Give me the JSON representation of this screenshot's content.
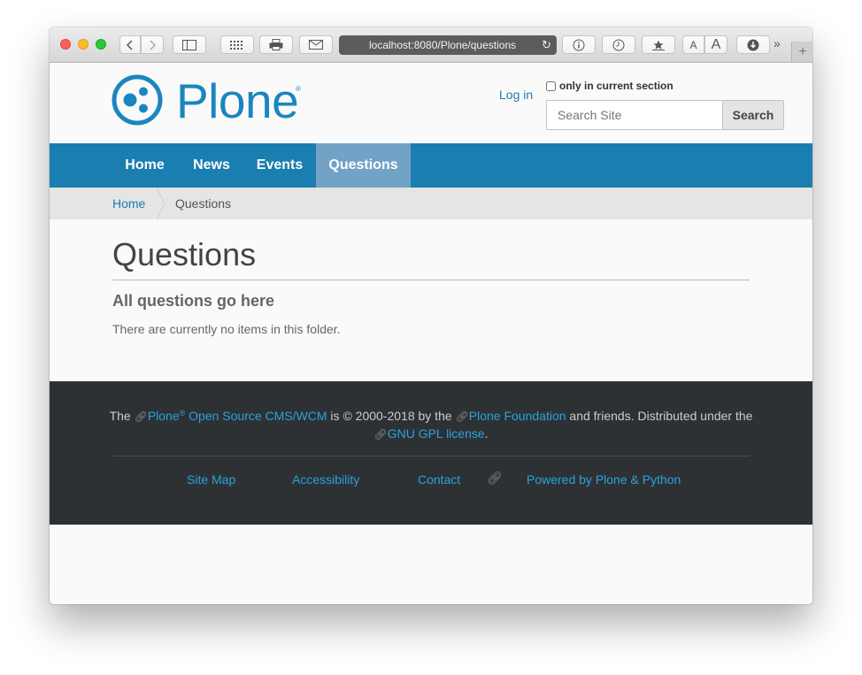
{
  "browser": {
    "url": "localhost:8080/Plone/questions",
    "chevron": "»",
    "newtab": "+",
    "font_small": "A",
    "font_large": "A"
  },
  "header": {
    "logo_text": "Plone",
    "logo_reg": "®",
    "login": "Log in",
    "current_section_label": "only in current section",
    "search_placeholder": "Search Site",
    "search_button": "Search"
  },
  "nav": {
    "items": [
      {
        "label": "Home"
      },
      {
        "label": "News"
      },
      {
        "label": "Events"
      },
      {
        "label": "Questions",
        "active": true
      }
    ]
  },
  "breadcrumbs": {
    "home": "Home",
    "current": "Questions"
  },
  "content": {
    "title": "Questions",
    "description": "All questions go here",
    "empty_message": "There are currently no items in this folder."
  },
  "footer": {
    "the": "The",
    "plone": "Plone",
    "reg": "®",
    "cms": "Open Source CMS/WCM",
    "is": "is",
    "copy": "©",
    "years_by": "2000-2018 by the",
    "foundation": "Plone Foundation",
    "and_friends": "and friends. Distributed under the",
    "gpl": "GNU GPL license",
    "period": ".",
    "links": {
      "sitemap": "Site Map",
      "accessibility": "Accessibility",
      "contact": "Contact",
      "powered": "Powered by Plone & Python"
    }
  },
  "colors": {
    "brand_blue": "#1a86be",
    "nav_bg": "#1a7eb0",
    "nav_active": "#73a2c7",
    "footer_bg": "#2e3133",
    "footer_link": "#27a3e0"
  }
}
